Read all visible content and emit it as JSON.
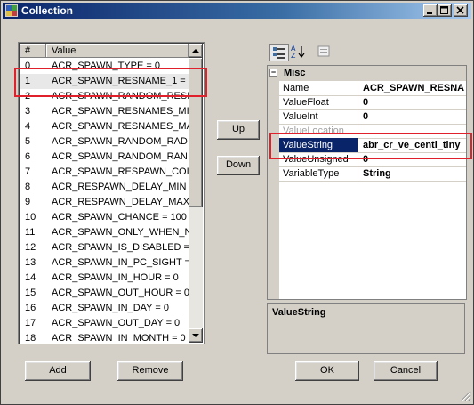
{
  "window": {
    "title": "Collection"
  },
  "list": {
    "header_index": "#",
    "header_value": "Value",
    "rows": [
      {
        "index": "0",
        "value": "ACR_SPAWN_TYPE = 0"
      },
      {
        "index": "1",
        "value": "ACR_SPAWN_RESNAME_1 ="
      },
      {
        "index": "2",
        "value": "ACR_SPAWN_RANDOM_RESI"
      },
      {
        "index": "3",
        "value": "ACR_SPAWN_RESNAMES_MI"
      },
      {
        "index": "4",
        "value": "ACR_SPAWN_RESNAMES_MA"
      },
      {
        "index": "5",
        "value": "ACR_SPAWN_RANDOM_RAD"
      },
      {
        "index": "6",
        "value": "ACR_SPAWN_RANDOM_RAN"
      },
      {
        "index": "7",
        "value": "ACR_SPAWN_RESPAWN_COI"
      },
      {
        "index": "8",
        "value": "ACR_RESPAWN_DELAY_MIN"
      },
      {
        "index": "9",
        "value": "ACR_RESPAWN_DELAY_MAX"
      },
      {
        "index": "10",
        "value": "ACR_SPAWN_CHANCE = 100"
      },
      {
        "index": "11",
        "value": "ACR_SPAWN_ONLY_WHEN_N"
      },
      {
        "index": "12",
        "value": "ACR_SPAWN_IS_DISABLED ="
      },
      {
        "index": "13",
        "value": "ACR_SPAWN_IN_PC_SIGHT ="
      },
      {
        "index": "14",
        "value": "ACR_SPAWN_IN_HOUR = 0"
      },
      {
        "index": "15",
        "value": "ACR_SPAWN_OUT_HOUR = 0"
      },
      {
        "index": "16",
        "value": "ACR_SPAWN_IN_DAY = 0"
      },
      {
        "index": "17",
        "value": "ACR_SPAWN_OUT_DAY = 0"
      },
      {
        "index": "18",
        "value": "ACR_SPAWN_IN_MONTH = 0"
      }
    ],
    "selected_index": 1
  },
  "buttons": {
    "up": "Up",
    "down": "Down",
    "add": "Add",
    "remove": "Remove",
    "ok": "OK",
    "cancel": "Cancel"
  },
  "property_grid": {
    "category": "Misc",
    "properties": [
      {
        "name": "Name",
        "value": "ACR_SPAWN_RESNA"
      },
      {
        "name": "ValueFloat",
        "value": "0"
      },
      {
        "name": "ValueInt",
        "value": "0"
      },
      {
        "name": "ValueLocation",
        "value": ""
      },
      {
        "name": "ValueString",
        "value": "abr_cr_ve_centi_tiny"
      },
      {
        "name": "ValueUnsigned",
        "value": "0"
      },
      {
        "name": "VariableType",
        "value": "String"
      }
    ],
    "description_title": "ValueString"
  },
  "colors": {
    "highlight": "#e0202a",
    "selection": "#0a246a",
    "titlebar": "#0a246a"
  }
}
